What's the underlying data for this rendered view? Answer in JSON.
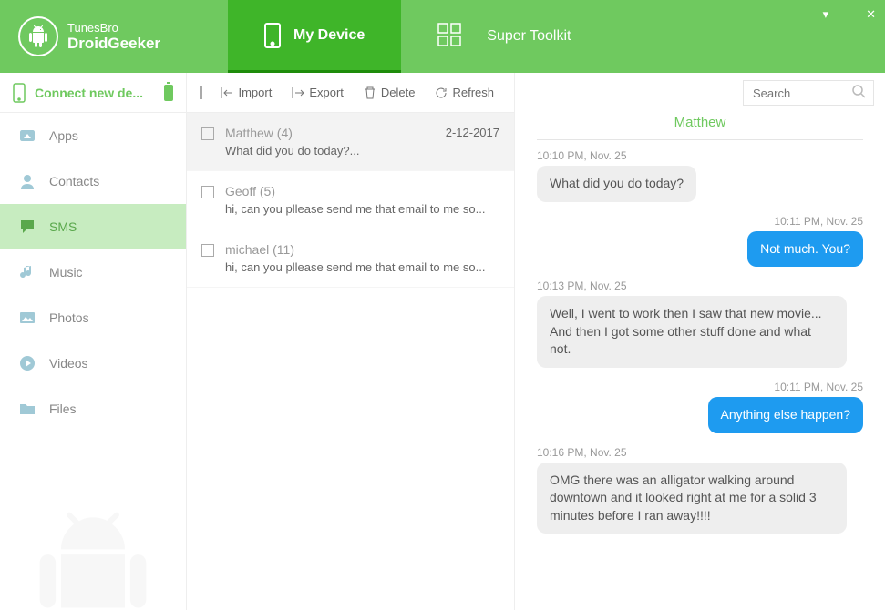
{
  "brand": {
    "line1": "TunesBro",
    "line2": "DroidGeeker"
  },
  "nav": {
    "my_device": "My Device",
    "super_toolkit": "Super Toolkit"
  },
  "sidebar": {
    "connect_label": "Connect new de...",
    "items": [
      {
        "label": "Apps"
      },
      {
        "label": "Contacts"
      },
      {
        "label": "SMS"
      },
      {
        "label": "Music"
      },
      {
        "label": "Photos"
      },
      {
        "label": "Videos"
      },
      {
        "label": "Files"
      }
    ]
  },
  "toolbar": {
    "import": "Import",
    "export": "Export",
    "delete": "Delete",
    "refresh": "Refresh"
  },
  "search": {
    "placeholder": "Search"
  },
  "conversations": [
    {
      "name": "Matthew (4)",
      "date": "2-12-2017",
      "preview": "What did you do today?..."
    },
    {
      "name": "Geoff (5)",
      "date": "",
      "preview": "hi, can you pllease send me that email to me so..."
    },
    {
      "name": "michael (11)",
      "date": "",
      "preview": "hi, can you pllease send me that email to me so..."
    }
  ],
  "chat": {
    "title": "Matthew",
    "messages": [
      {
        "time": "10:10 PM, Nov. 25",
        "dir": "in",
        "text": "What did you do today?"
      },
      {
        "time": "10:11 PM, Nov. 25",
        "dir": "out",
        "text": "Not much. You?"
      },
      {
        "time": "10:13 PM, Nov. 25",
        "dir": "in",
        "text": " Well, I went to work then I saw that new movie... And then I got some other stuff done and  what not."
      },
      {
        "time": "10:11 PM, Nov. 25",
        "dir": "out",
        "text": "Anything else happen?"
      },
      {
        "time": "10:16 PM, Nov. 25",
        "dir": "in",
        "text": "  OMG there was an alligator walking around downtown and it looked right at me for a solid 3 minutes before I ran away!!!!"
      }
    ]
  }
}
